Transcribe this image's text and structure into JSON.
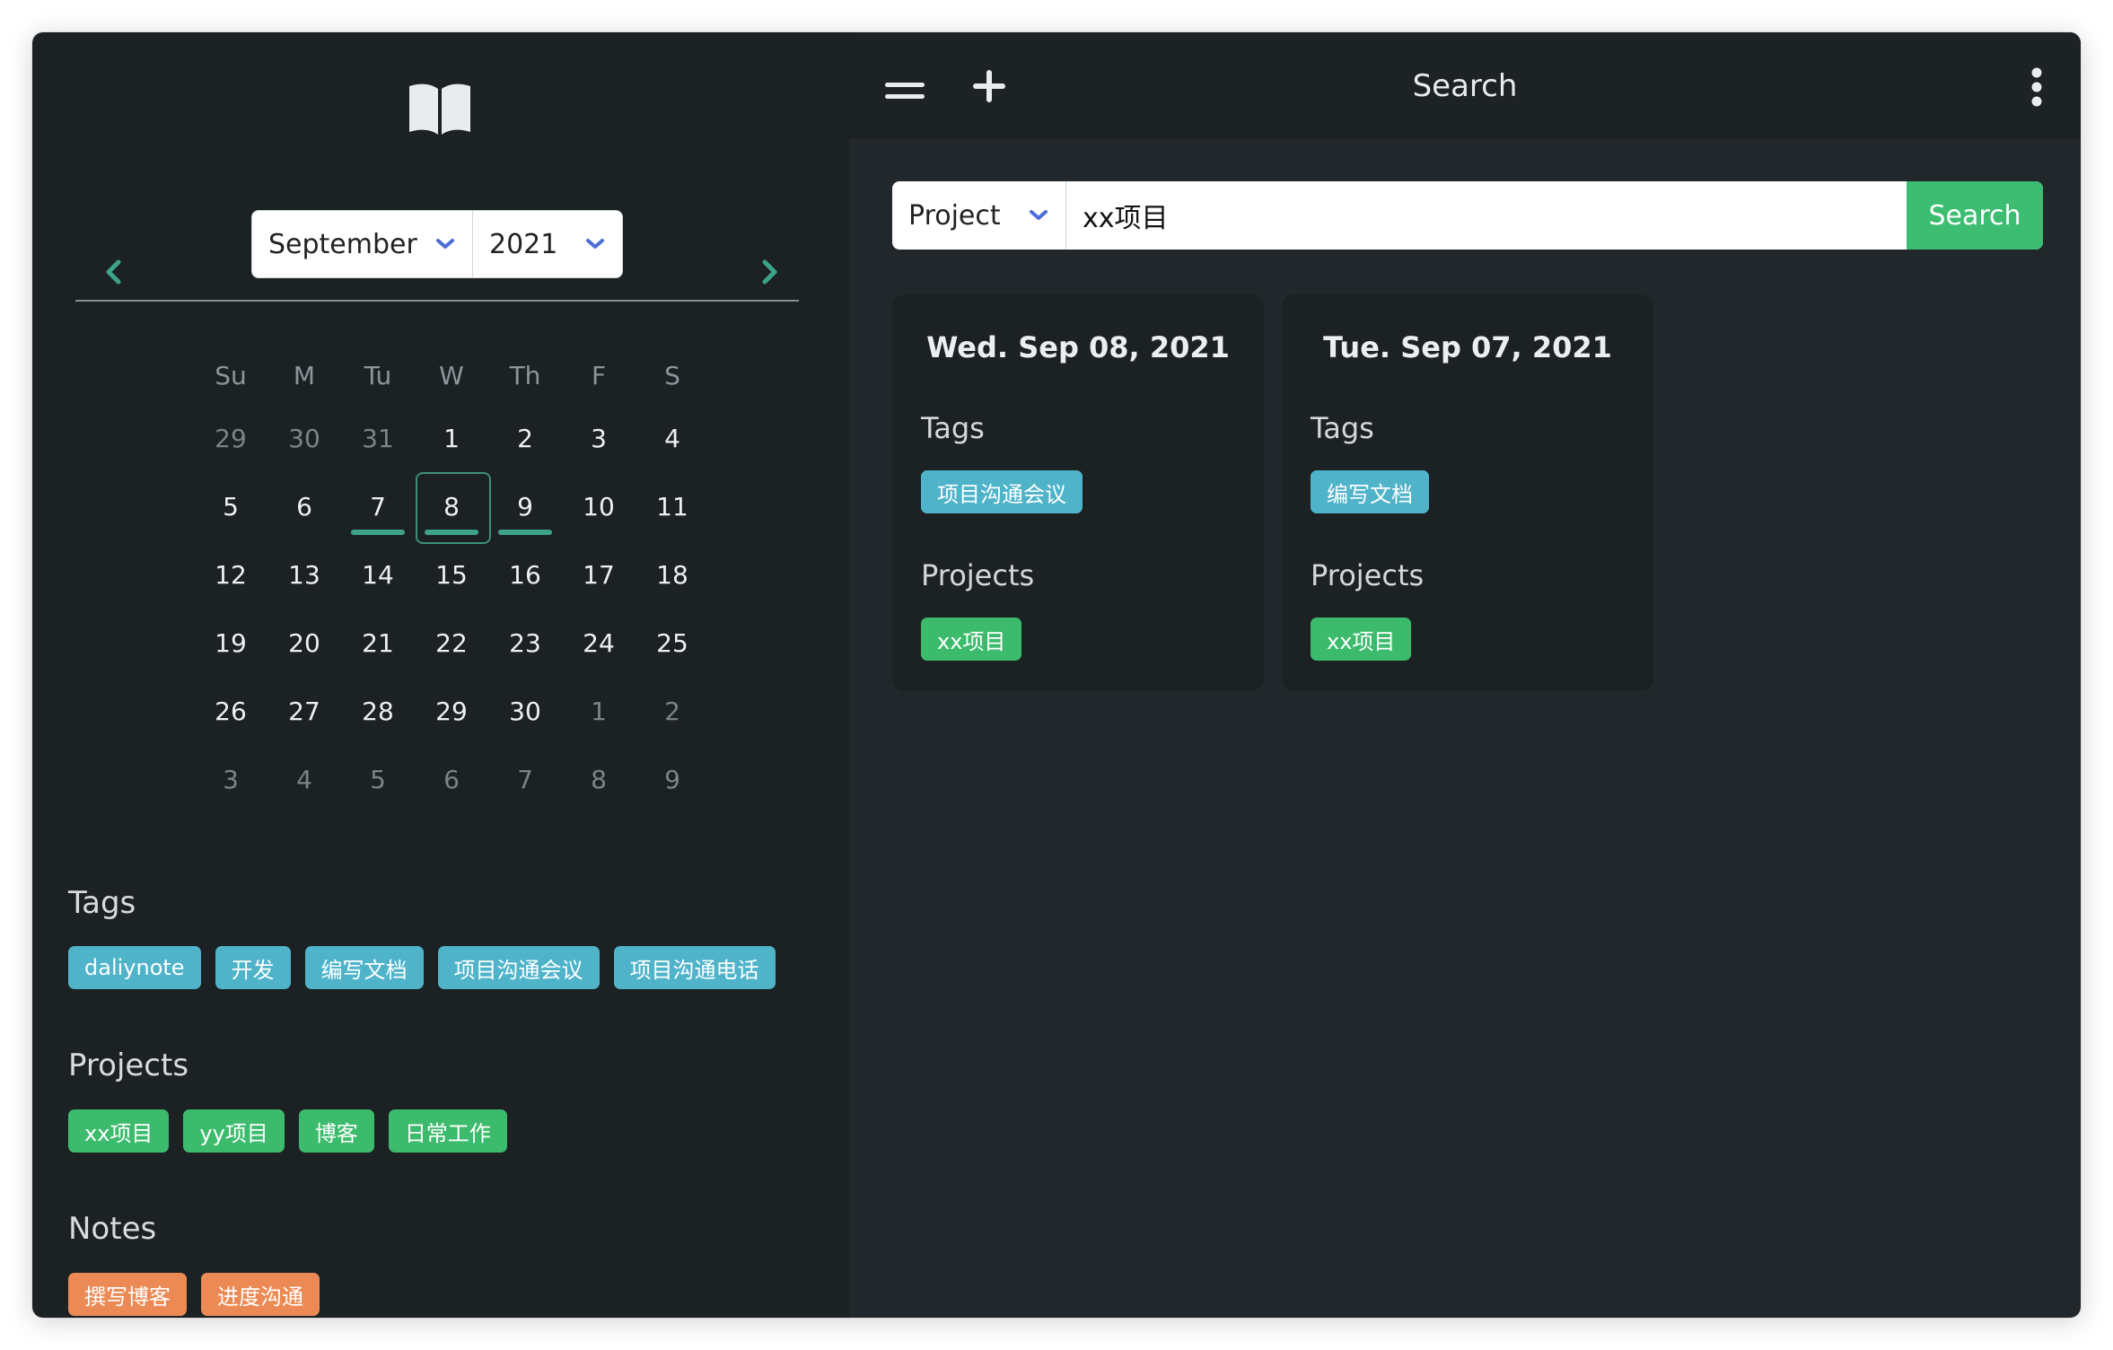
{
  "colors": {
    "accent_green": "#3dbb6d",
    "tag_blue": "#4fb3c9",
    "note_orange": "#ec8a55",
    "calendar_mark": "#3ea38a"
  },
  "sidebar": {
    "logo_icon": "open-book-icon",
    "calendar": {
      "month": "September",
      "year": "2021",
      "weekdays": [
        "Su",
        "M",
        "Tu",
        "W",
        "Th",
        "F",
        "S"
      ],
      "weeks": [
        [
          "29",
          "30",
          "31",
          "1",
          "2",
          "3",
          "4"
        ],
        [
          "5",
          "6",
          "7",
          "8",
          "9",
          "10",
          "11"
        ],
        [
          "12",
          "13",
          "14",
          "15",
          "16",
          "17",
          "18"
        ],
        [
          "19",
          "20",
          "21",
          "22",
          "23",
          "24",
          "25"
        ],
        [
          "26",
          "27",
          "28",
          "29",
          "30",
          "1",
          "2"
        ],
        [
          "3",
          "4",
          "5",
          "6",
          "7",
          "8",
          "9"
        ]
      ],
      "selected_day": "8",
      "marked_days": [
        "7",
        "8",
        "9"
      ]
    },
    "tags_title": "Tags",
    "tags": [
      "daliynote",
      "开发",
      "编写文档",
      "项目沟通会议",
      "项目沟通电话"
    ],
    "projects_title": "Projects",
    "projects": [
      "xx项目",
      "yy项目",
      "博客",
      "日常工作"
    ],
    "notes_title": "Notes",
    "notes": [
      "撰写博客",
      "进度沟通"
    ]
  },
  "topbar": {
    "title": "Search"
  },
  "search": {
    "type": "Project",
    "query": "xx项目",
    "button_label": "Search"
  },
  "results": [
    {
      "date": "Wed. Sep 08, 2021",
      "tags_label": "Tags",
      "tags": [
        "项目沟通会议"
      ],
      "projects_label": "Projects",
      "projects": [
        "xx项目"
      ]
    },
    {
      "date": "Tue. Sep 07, 2021",
      "tags_label": "Tags",
      "tags": [
        "编写文档"
      ],
      "projects_label": "Projects",
      "projects": [
        "xx项目"
      ]
    }
  ]
}
